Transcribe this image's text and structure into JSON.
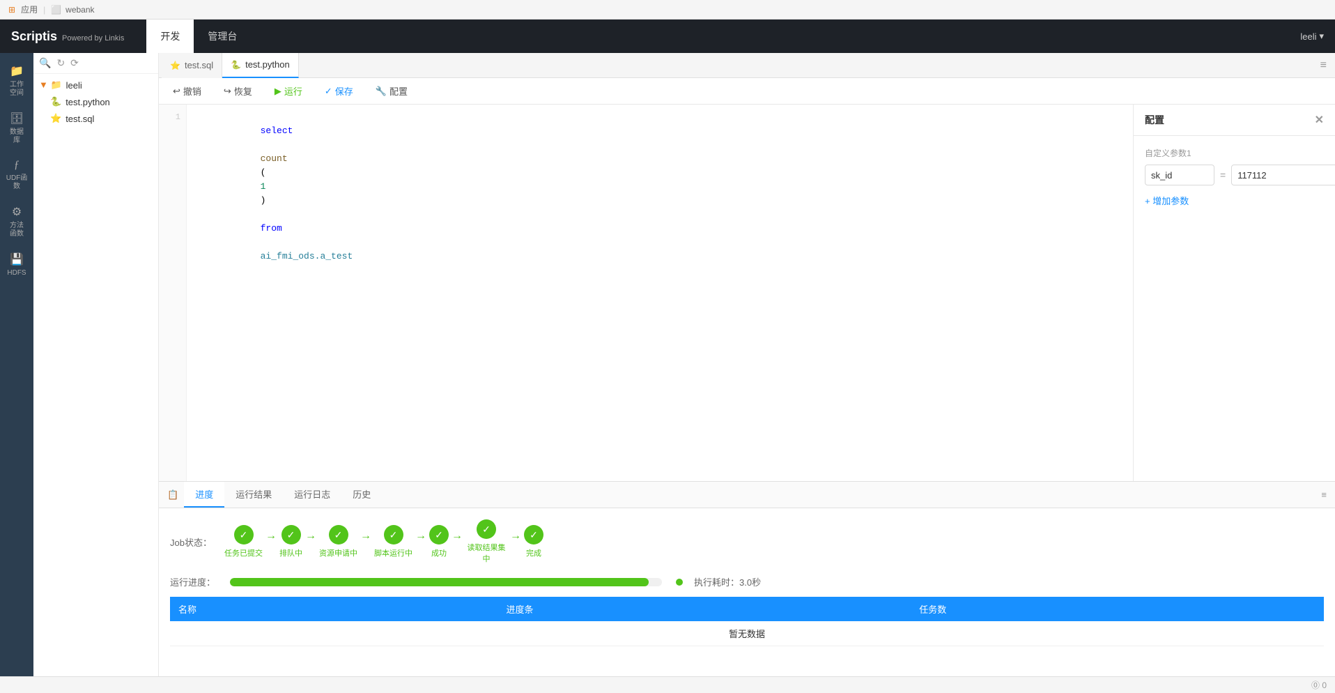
{
  "osbar": {
    "apps_label": "应用",
    "window_title": "webank"
  },
  "topbar": {
    "logo": "Scriptis",
    "logo_sub": "Powered by Linkis",
    "nav_dev": "开发",
    "nav_admin": "管理台",
    "user": "leeli",
    "user_arrow": "▾"
  },
  "tabs": [
    {
      "icon": "⭐",
      "label": "test.sql",
      "type": "sql"
    },
    {
      "icon": "🐍",
      "label": "test.python",
      "type": "python"
    }
  ],
  "active_tab_index": 1,
  "toolbar": {
    "undo": "撤销",
    "redo": "恢复",
    "run": "运行",
    "save": "保存",
    "config": "配置"
  },
  "editor": {
    "lines": [
      {
        "number": 1,
        "code": "select  count(1) from ai_fmi_ods.a_test"
      }
    ]
  },
  "file_tree": {
    "root": "leeli",
    "items": [
      {
        "type": "python",
        "label": "test.python"
      },
      {
        "type": "sql",
        "label": "test.sql"
      }
    ]
  },
  "sidebar_icons": [
    {
      "icon": "📁",
      "label": "工作\n空间"
    },
    {
      "icon": "🗄️",
      "label": "数据\n库"
    },
    {
      "icon": "ƒ",
      "label": "UDF函\n数"
    },
    {
      "icon": "⚙️",
      "label": "方法\n函数"
    },
    {
      "icon": "💾",
      "label": "HDFS"
    }
  ],
  "config_panel": {
    "title": "配置",
    "param_label": "自定义参数1",
    "param_key": "sk_id",
    "param_equals": "=",
    "param_value": "117112",
    "add_btn": "+ 增加参数"
  },
  "bottom_panel": {
    "tabs": [
      "进度",
      "运行结果",
      "运行日志",
      "历史"
    ],
    "active_tab": 0,
    "job_status_label": "Job状态：",
    "steps": [
      {
        "label": "任务已提交"
      },
      {
        "label": "排队中"
      },
      {
        "label": "资源申请中"
      },
      {
        "label": "脚本运行中"
      },
      {
        "label": "成功"
      },
      {
        "label": "读取结果集中"
      },
      {
        "label": "完成"
      }
    ],
    "run_progress_label": "运行进度：",
    "progress_percent": 97,
    "run_time_label": "执行耗时：3.0秒",
    "table_cols": [
      "名称",
      "进度条",
      "任务数"
    ],
    "empty_text": "暂无数据"
  },
  "status_bar": {
    "info": "⓪ 0"
  }
}
